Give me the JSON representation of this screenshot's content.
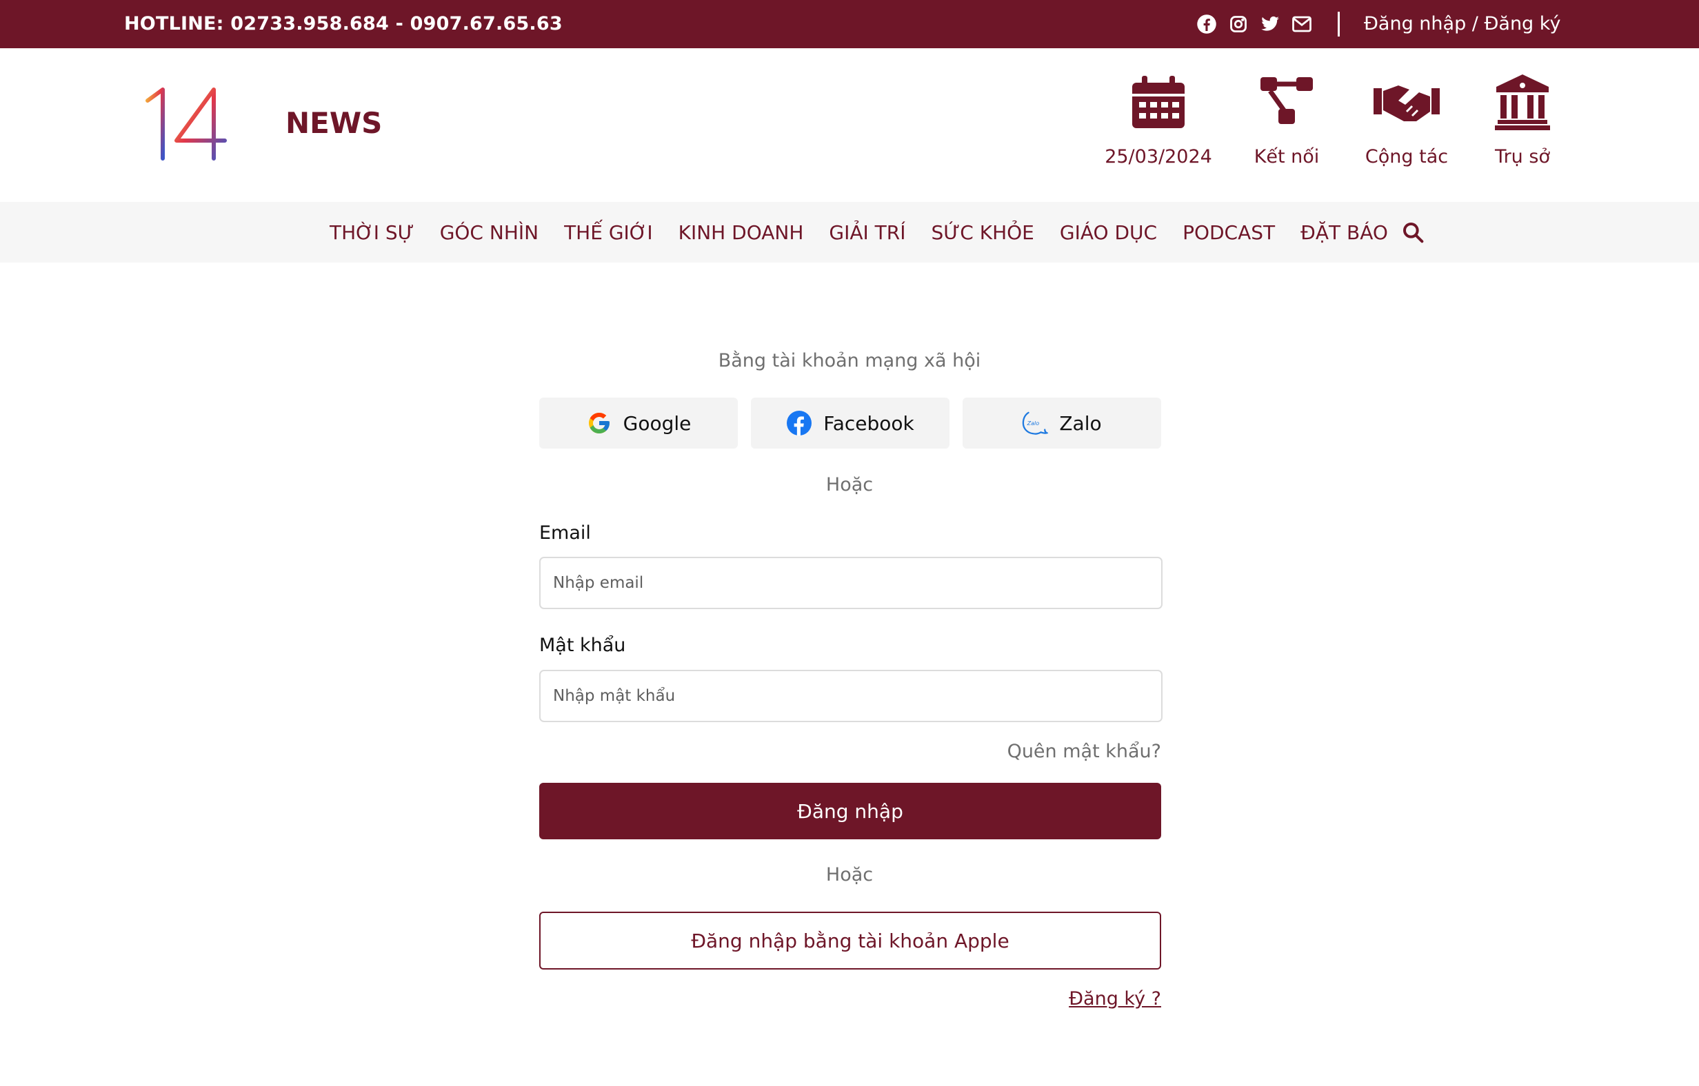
{
  "topbar": {
    "hotline": "HOTLINE: 02733.958.684 - 0907.67.65.63",
    "social_icons": [
      "facebook-icon",
      "instagram-icon",
      "twitter-icon",
      "mail-icon"
    ],
    "auth_link": "Đăng nhập / Đăng ký"
  },
  "header": {
    "logo_text": "14",
    "brand": "NEWS",
    "icons": [
      {
        "icon": "calendar-icon",
        "label": "25/03/2024"
      },
      {
        "icon": "network-icon",
        "label": "Kết nối"
      },
      {
        "icon": "handshake-icon",
        "label": "Cộng tác"
      },
      {
        "icon": "building-icon",
        "label": "Trụ sở"
      }
    ]
  },
  "nav": {
    "items": [
      "THỜI SỰ",
      "GÓC NHÌN",
      "THẾ GIỚI",
      "KINH DOANH",
      "GIẢI TRÍ",
      "SỨC KHỎE",
      "GIÁO DỤC",
      "PODCAST",
      "ĐẶT BÁO"
    ]
  },
  "login": {
    "social_heading": "Bằng tài khoản mạng xã hội",
    "social_buttons": [
      {
        "icon": "google-icon",
        "label": "Google"
      },
      {
        "icon": "facebook-icon",
        "label": "Facebook"
      },
      {
        "icon": "zalo-icon",
        "label": "Zalo"
      }
    ],
    "or_text": "Hoặc",
    "email_label": "Email",
    "email_placeholder": "Nhập email",
    "password_label": "Mật khẩu",
    "password_placeholder": "Nhập mật khẩu",
    "forgot": "Quên mật khẩu?",
    "submit": "Đăng nhập",
    "or_text_2": "Hoặc",
    "apple": "Đăng nhập bằng tài khoản Apple",
    "register": "Đăng ký ?"
  },
  "colors": {
    "brand": "#6e1628",
    "nav_bg": "#f6f6f6",
    "muted_text": "#6f6f6f"
  }
}
